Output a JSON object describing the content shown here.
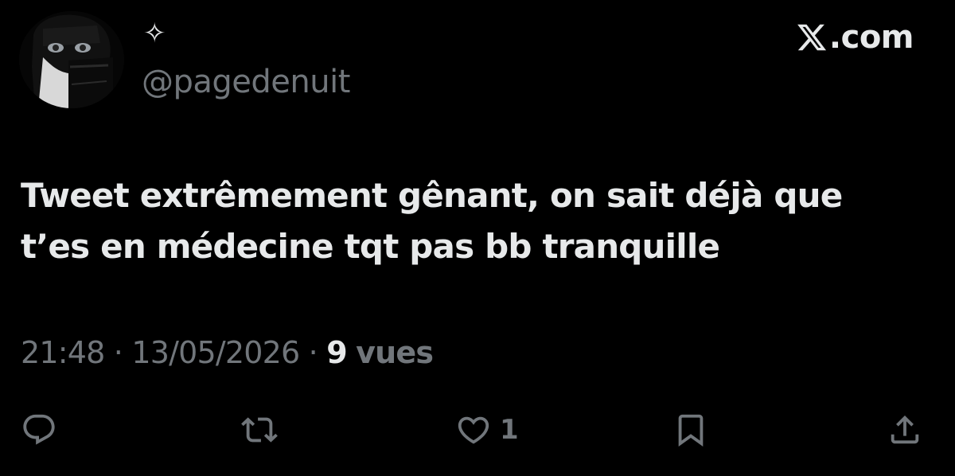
{
  "author": {
    "display_name": "✧",
    "handle": "@pagedenuit",
    "avatar_icon": "avatar-image"
  },
  "brand": {
    "logo_icon": "x-logo-icon",
    "domain": ".com"
  },
  "tweet": {
    "text": "Tweet extrêmement gênant, on sait déjà que t’es en médecine tqt pas bb tranquille",
    "time": "21:48",
    "separator": "·",
    "date": "13/05/2026",
    "views_count": "9",
    "views_label": "vues"
  },
  "actions": {
    "reply_icon": "reply-icon",
    "repost_icon": "repost-icon",
    "like_icon": "heart-icon",
    "like_count": "1",
    "bookmark_icon": "bookmark-icon",
    "share_icon": "share-icon"
  },
  "colors": {
    "background": "#000000",
    "primary_text": "#e7e9ea",
    "secondary_text": "#71767b"
  }
}
